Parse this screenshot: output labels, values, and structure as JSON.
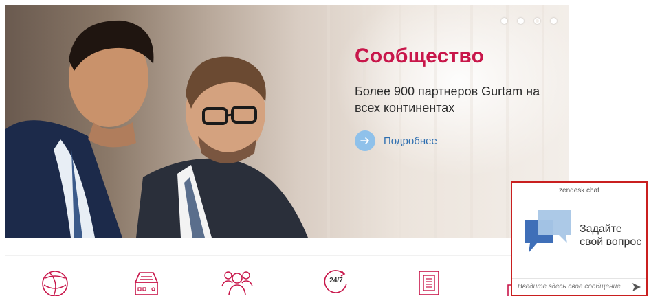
{
  "hero": {
    "title": "Сообщество",
    "text": "Более 900 партнеров Gurtam на всех континентах",
    "more_label": "Подробнее",
    "slider": {
      "count": 4,
      "active_index": 2
    }
  },
  "features": {
    "icons": [
      "globe-icon",
      "server-device-icon",
      "people-group-icon",
      "support-24-7-icon",
      "documents-icon",
      "partial-icon"
    ],
    "support_label": "24/7"
  },
  "chat": {
    "header": "zendesk chat",
    "prompt_line1": "Задайте",
    "prompt_line2": "свой вопрос",
    "input_placeholder": "Введите здесь свое сообщение"
  },
  "colors": {
    "accent": "#c8164a",
    "link": "#2f6fb0",
    "chat_border": "#c91f1f",
    "icon": "#c8164a"
  }
}
